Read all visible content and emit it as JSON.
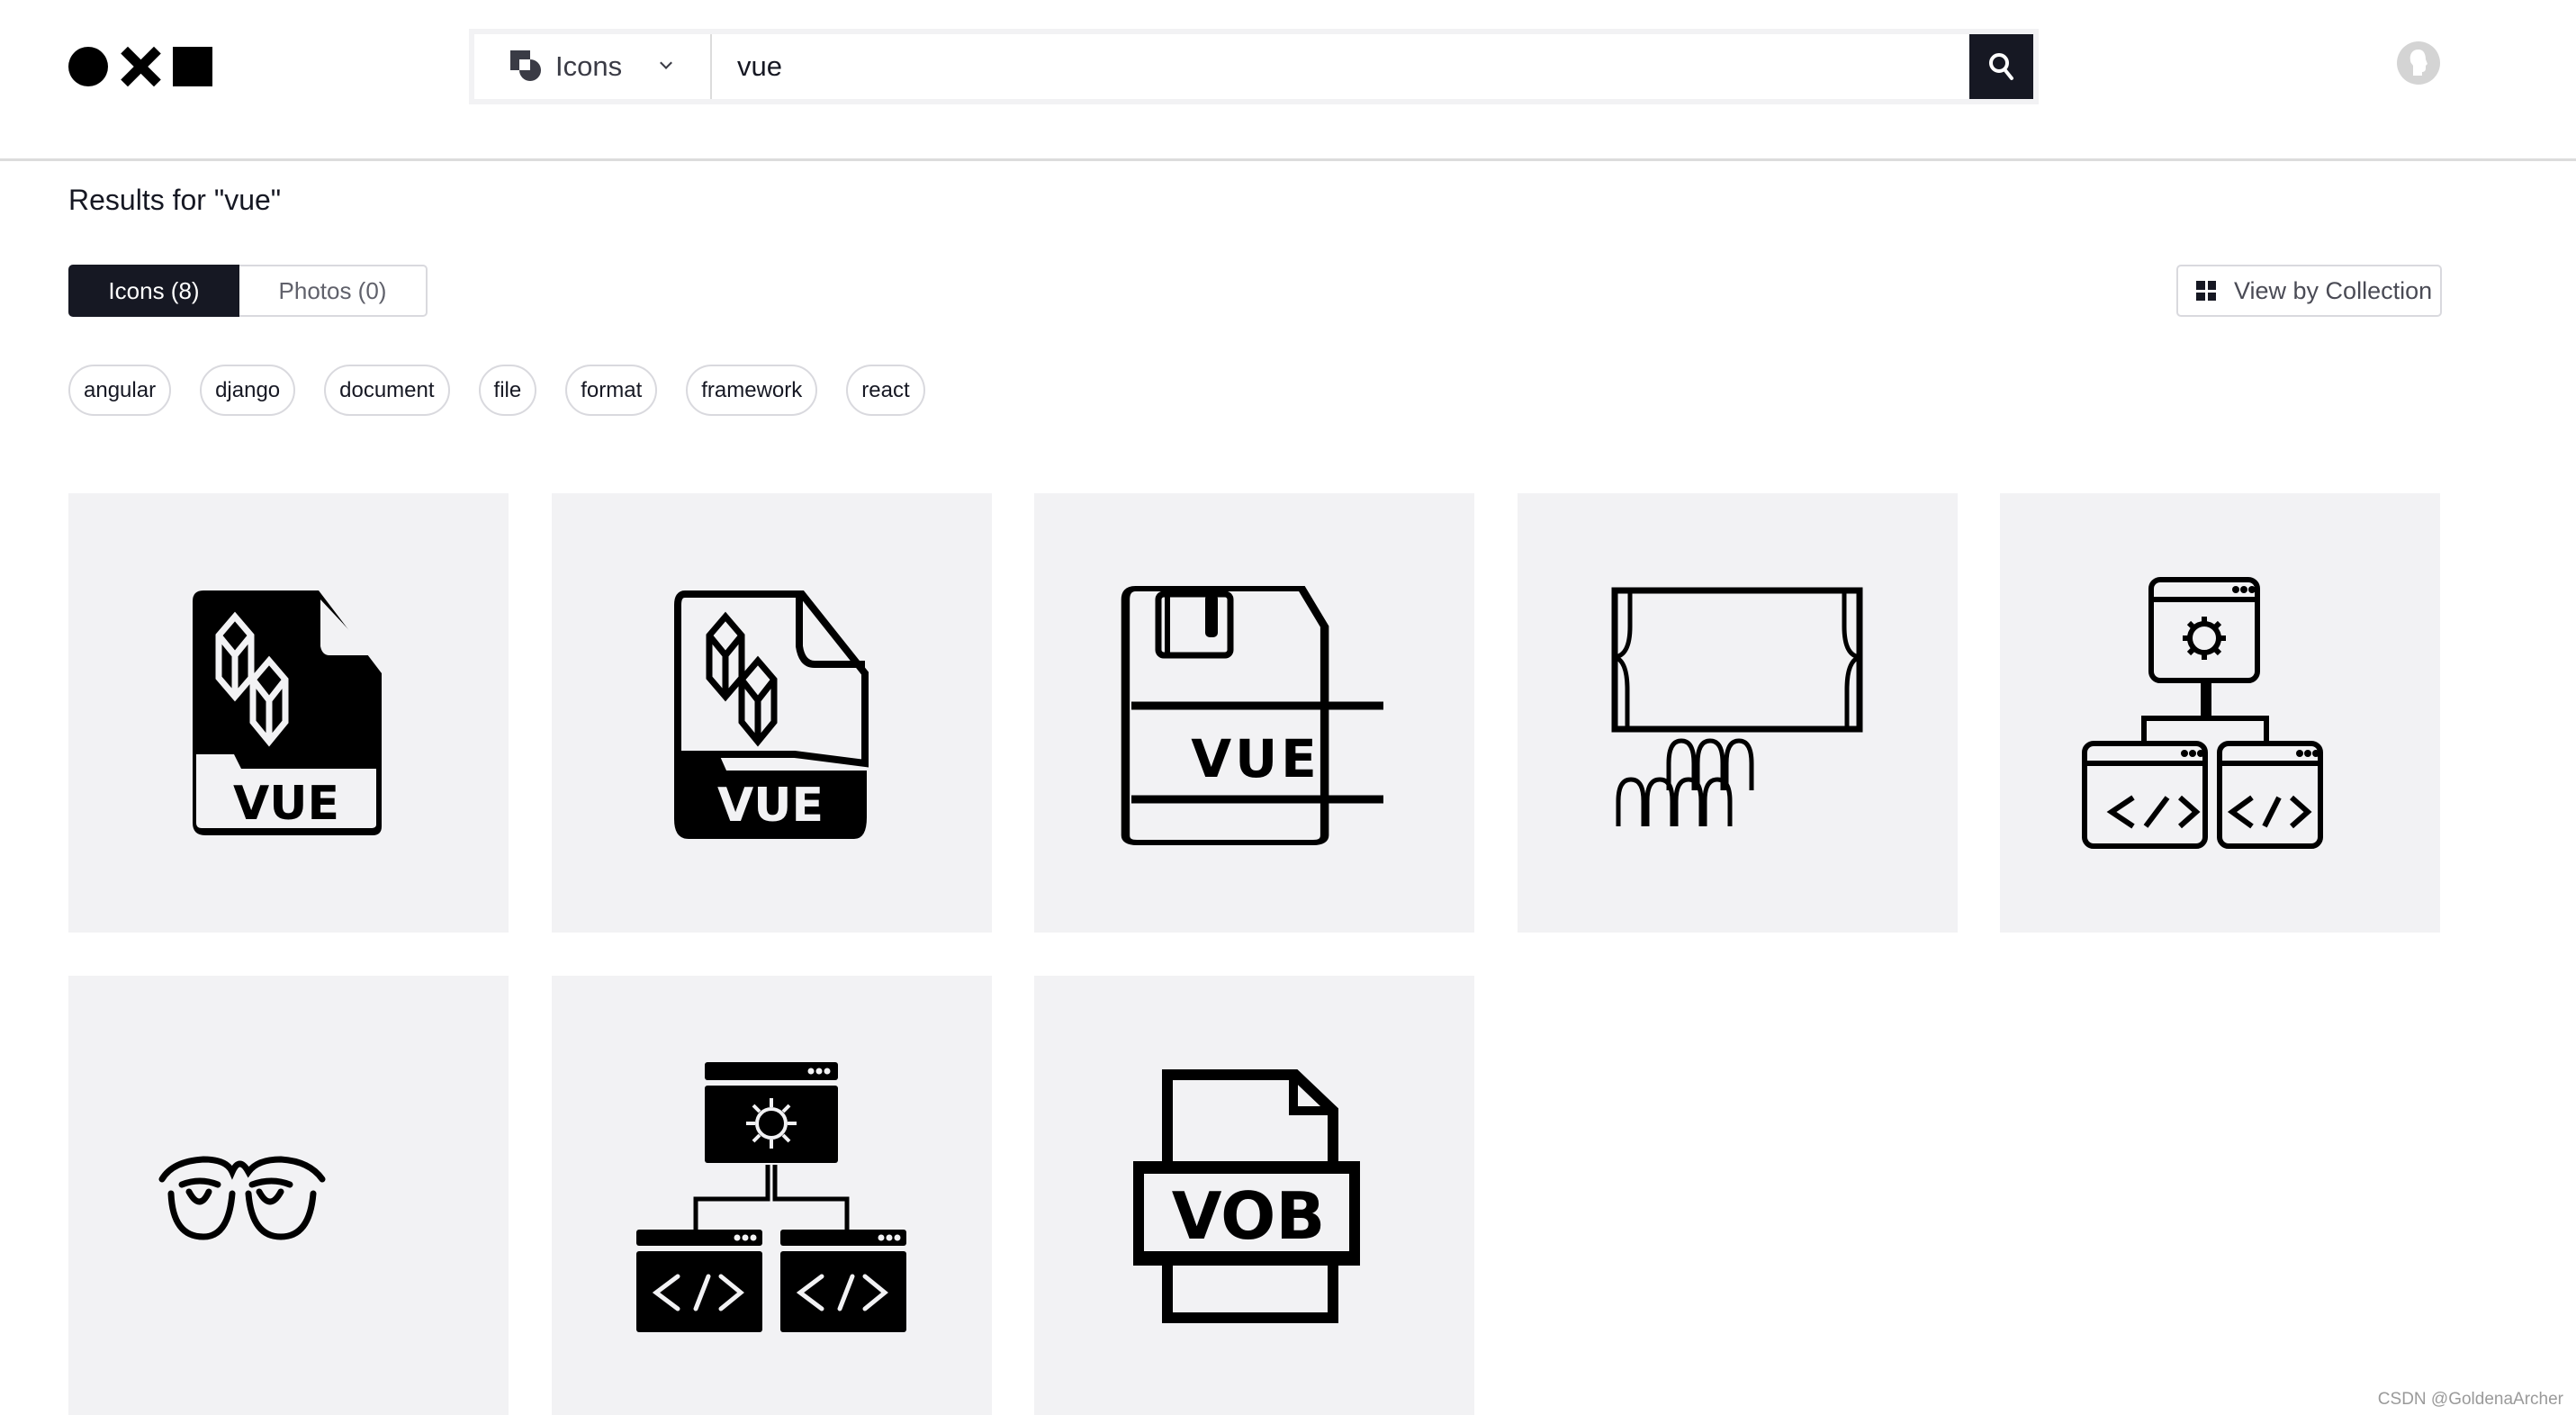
{
  "header": {
    "logo_label": "Noun Project",
    "search": {
      "type_label": "Icons",
      "value": "vue",
      "placeholder": ""
    }
  },
  "results": {
    "title": "Results for \"vue\"",
    "tabs": [
      {
        "label": "Icons (8)",
        "active": true
      },
      {
        "label": "Photos (0)",
        "active": false
      }
    ],
    "view_by_collection_label": "View by Collection",
    "related_tags": [
      "angular",
      "django",
      "document",
      "file",
      "format",
      "framework",
      "react"
    ],
    "icons": [
      {
        "name": "vue-file-filled",
        "caption": "VUE"
      },
      {
        "name": "vue-file-outline-dark-label",
        "caption": "VUE"
      },
      {
        "name": "vue-floppy-disk",
        "caption": "VUE"
      },
      {
        "name": "stage-audience",
        "caption": ""
      },
      {
        "name": "code-framework-outline",
        "caption": ""
      },
      {
        "name": "glasses-eyes",
        "caption": ""
      },
      {
        "name": "code-framework-filled",
        "caption": ""
      },
      {
        "name": "vob-file",
        "caption": "VOB"
      }
    ]
  },
  "colors": {
    "primary_dark": "#161823",
    "card_background": "#f2f2f4",
    "border": "#d9d9de"
  },
  "watermark": "CSDN @GoldenaArcher"
}
